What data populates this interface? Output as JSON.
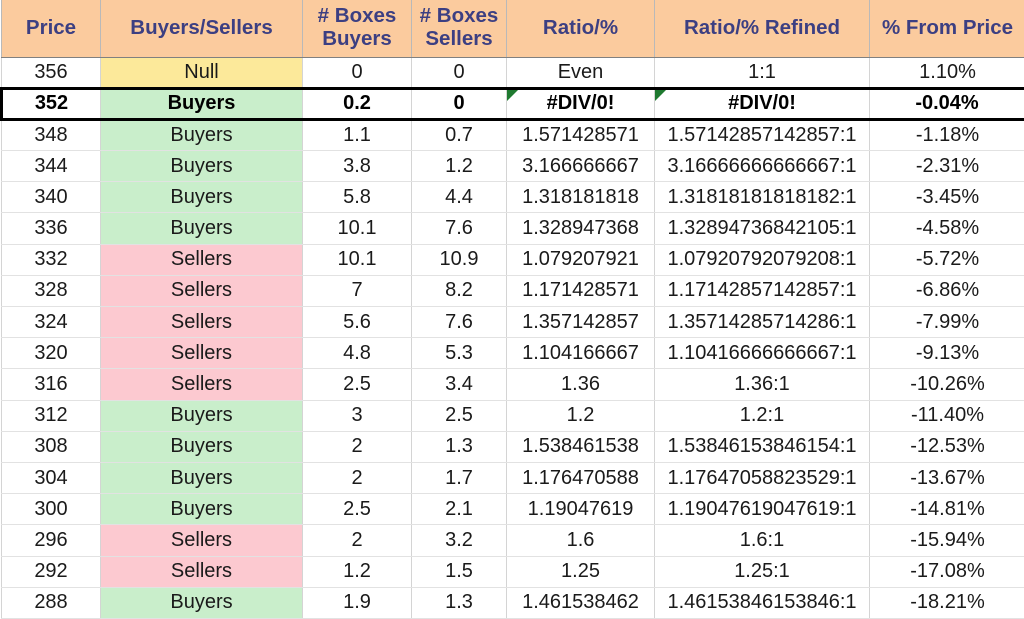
{
  "table": {
    "columns": [
      {
        "key": "price",
        "label": "Price",
        "label2": ""
      },
      {
        "key": "bs",
        "label": "Buyers/Sellers",
        "label2": ""
      },
      {
        "key": "bb",
        "label": "# Boxes",
        "label2": "Buyers"
      },
      {
        "key": "bsl",
        "label": "# Boxes",
        "label2": "Sellers"
      },
      {
        "key": "ratio",
        "label": "Ratio/%",
        "label2": ""
      },
      {
        "key": "refined",
        "label": "Ratio/% Refined",
        "label2": ""
      },
      {
        "key": "pct",
        "label": "% From Price",
        "label2": ""
      }
    ],
    "rows": [
      {
        "price": "356",
        "bs": "Null",
        "fill": "null",
        "bb": "0",
        "bsl": "0",
        "ratio": "Even",
        "refined": "1:1",
        "pct": "1.10%",
        "selected": false,
        "error_flag": false
      },
      {
        "price": "352",
        "bs": "Buyers",
        "fill": "buyers",
        "bb": "0.2",
        "bsl": "0",
        "ratio": "#DIV/0!",
        "refined": "#DIV/0!",
        "pct": "-0.04%",
        "selected": true,
        "error_flag": true
      },
      {
        "price": "348",
        "bs": "Buyers",
        "fill": "buyers",
        "bb": "1.1",
        "bsl": "0.7",
        "ratio": "1.571428571",
        "refined": "1.57142857142857:1",
        "pct": "-1.18%",
        "selected": false,
        "error_flag": false
      },
      {
        "price": "344",
        "bs": "Buyers",
        "fill": "buyers",
        "bb": "3.8",
        "bsl": "1.2",
        "ratio": "3.166666667",
        "refined": "3.16666666666667:1",
        "pct": "-2.31%",
        "selected": false,
        "error_flag": false
      },
      {
        "price": "340",
        "bs": "Buyers",
        "fill": "buyers",
        "bb": "5.8",
        "bsl": "4.4",
        "ratio": "1.318181818",
        "refined": "1.31818181818182:1",
        "pct": "-3.45%",
        "selected": false,
        "error_flag": false
      },
      {
        "price": "336",
        "bs": "Buyers",
        "fill": "buyers",
        "bb": "10.1",
        "bsl": "7.6",
        "ratio": "1.328947368",
        "refined": "1.32894736842105:1",
        "pct": "-4.58%",
        "selected": false,
        "error_flag": false
      },
      {
        "price": "332",
        "bs": "Sellers",
        "fill": "sellers",
        "bb": "10.1",
        "bsl": "10.9",
        "ratio": "1.079207921",
        "refined": "1.07920792079208:1",
        "pct": "-5.72%",
        "selected": false,
        "error_flag": false
      },
      {
        "price": "328",
        "bs": "Sellers",
        "fill": "sellers",
        "bb": "7",
        "bsl": "8.2",
        "ratio": "1.171428571",
        "refined": "1.17142857142857:1",
        "pct": "-6.86%",
        "selected": false,
        "error_flag": false
      },
      {
        "price": "324",
        "bs": "Sellers",
        "fill": "sellers",
        "bb": "5.6",
        "bsl": "7.6",
        "ratio": "1.357142857",
        "refined": "1.35714285714286:1",
        "pct": "-7.99%",
        "selected": false,
        "error_flag": false
      },
      {
        "price": "320",
        "bs": "Sellers",
        "fill": "sellers",
        "bb": "4.8",
        "bsl": "5.3",
        "ratio": "1.104166667",
        "refined": "1.10416666666667:1",
        "pct": "-9.13%",
        "selected": false,
        "error_flag": false
      },
      {
        "price": "316",
        "bs": "Sellers",
        "fill": "sellers",
        "bb": "2.5",
        "bsl": "3.4",
        "ratio": "1.36",
        "refined": "1.36:1",
        "pct": "-10.26%",
        "selected": false,
        "error_flag": false
      },
      {
        "price": "312",
        "bs": "Buyers",
        "fill": "buyers",
        "bb": "3",
        "bsl": "2.5",
        "ratio": "1.2",
        "refined": "1.2:1",
        "pct": "-11.40%",
        "selected": false,
        "error_flag": false
      },
      {
        "price": "308",
        "bs": "Buyers",
        "fill": "buyers",
        "bb": "2",
        "bsl": "1.3",
        "ratio": "1.538461538",
        "refined": "1.53846153846154:1",
        "pct": "-12.53%",
        "selected": false,
        "error_flag": false
      },
      {
        "price": "304",
        "bs": "Buyers",
        "fill": "buyers",
        "bb": "2",
        "bsl": "1.7",
        "ratio": "1.176470588",
        "refined": "1.17647058823529:1",
        "pct": "-13.67%",
        "selected": false,
        "error_flag": false
      },
      {
        "price": "300",
        "bs": "Buyers",
        "fill": "buyers",
        "bb": "2.5",
        "bsl": "2.1",
        "ratio": "1.19047619",
        "refined": "1.19047619047619:1",
        "pct": "-14.81%",
        "selected": false,
        "error_flag": false
      },
      {
        "price": "296",
        "bs": "Sellers",
        "fill": "sellers",
        "bb": "2",
        "bsl": "3.2",
        "ratio": "1.6",
        "refined": "1.6:1",
        "pct": "-15.94%",
        "selected": false,
        "error_flag": false
      },
      {
        "price": "292",
        "bs": "Sellers",
        "fill": "sellers",
        "bb": "1.2",
        "bsl": "1.5",
        "ratio": "1.25",
        "refined": "1.25:1",
        "pct": "-17.08%",
        "selected": false,
        "error_flag": false
      },
      {
        "price": "288",
        "bs": "Buyers",
        "fill": "buyers",
        "bb": "1.9",
        "bsl": "1.3",
        "ratio": "1.461538462",
        "refined": "1.46153846153846:1",
        "pct": "-18.21%",
        "selected": false,
        "error_flag": false
      }
    ]
  },
  "colors": {
    "header_fill": "#fbcb9e",
    "header_text": "#3c3f82",
    "buyers_fill": "#c9eecb",
    "buyers_text": "#1e7a1e",
    "sellers_fill": "#fcc9d0",
    "sellers_text": "#b50d2e",
    "null_fill": "#fce99a",
    "null_text": "#a8781d",
    "error_flag": "#1f7a30",
    "selection_border": "#000000"
  }
}
